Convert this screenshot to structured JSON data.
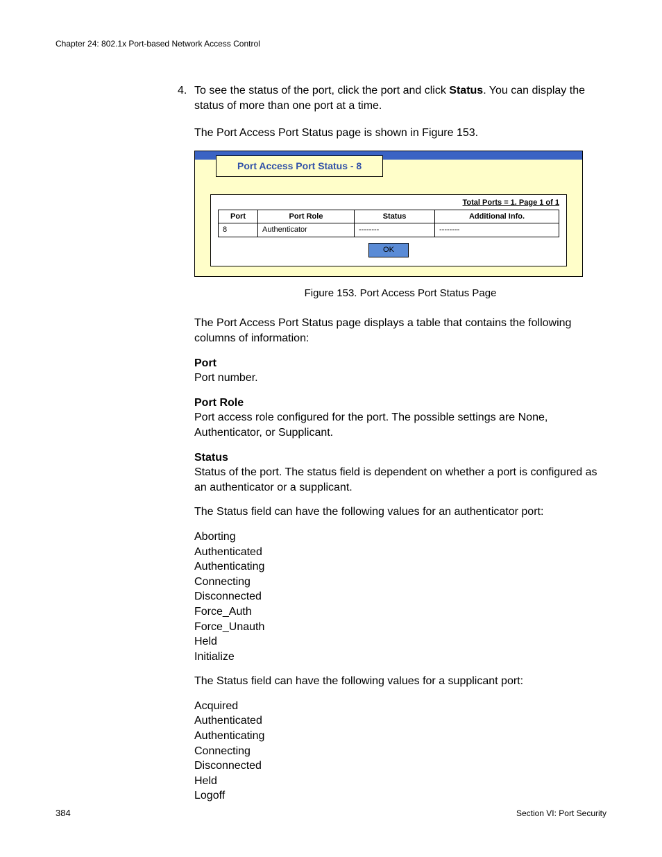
{
  "header": {
    "chapter": "Chapter 24: 802.1x Port-based Network Access Control"
  },
  "step": {
    "number": "4.",
    "before_bold": "To see the status of the port, click the port and click ",
    "bold": "Status",
    "after_bold": ". You can display the status of more than one port at a time."
  },
  "lead_sentence": "The Port Access Port Status page is shown in Figure 153.",
  "figure": {
    "title": "Port Access Port Status - 8",
    "summary": "Total Ports = 1. Page 1 of 1",
    "columns": {
      "c1": "Port",
      "c2": "Port Role",
      "c3": "Status",
      "c4": "Additional Info."
    },
    "row": {
      "port": "8",
      "role": "Authenticator",
      "status": "--------",
      "info": "--------"
    },
    "ok": "OK",
    "caption": "Figure 153. Port Access Port Status Page"
  },
  "intro": "The Port Access Port Status page displays a table that contains the following columns of information:",
  "defs": {
    "port": {
      "label": "Port",
      "text": "Port number."
    },
    "role": {
      "label": "Port Role",
      "text": "Port access role configured for the port. The possible settings are None, Authenticator, or Supplicant."
    },
    "status": {
      "label": "Status",
      "text": "Status of the port. The status field is dependent on whether a port is configured as an authenticator or a supplicant."
    }
  },
  "auth_intro": "The Status field can have the following values for an authenticator port:",
  "auth_values": [
    "Aborting",
    "Authenticated",
    "Authenticating",
    "Connecting",
    "Disconnected",
    "Force_Auth",
    "Force_Unauth",
    "Held",
    "Initialize"
  ],
  "supp_intro": "The Status field can have the following values for a supplicant port:",
  "supp_values": [
    "Acquired",
    "Authenticated",
    "Authenticating",
    "Connecting",
    "Disconnected",
    "Held",
    "Logoff"
  ],
  "footer": {
    "page_number": "384",
    "section": "Section VI: Port Security"
  }
}
